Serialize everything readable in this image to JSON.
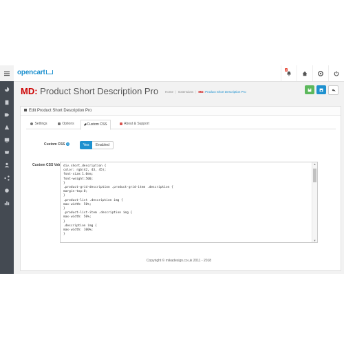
{
  "header": {
    "logo": "opencart",
    "badge_count": "2"
  },
  "page": {
    "title_prefix": "MD:",
    "title": "Product Short Description Pro",
    "breadcrumb": {
      "home": "Home",
      "extensions": "Extensions",
      "current_prefix": "MD:",
      "current": "Product Short Description Pro"
    }
  },
  "panel": {
    "heading": "Edit Product Short Description Pro",
    "tabs": [
      {
        "label": "Settings"
      },
      {
        "label": "Options"
      },
      {
        "label": "Custom CSS"
      },
      {
        "label": "About & Support"
      }
    ],
    "custom_css": {
      "label": "Custom CSS",
      "toggle_yes": "Yes",
      "toggle_state": "Enabled"
    },
    "custom_css_value": {
      "label": "Custom CSS Value",
      "lines": [
        "div.short_description {",
        "color: rgb(42, 43, 45);",
        "font-size:1.0em;",
        "font-weight:500;",
        "}",
        ".product-grid-description .product-grid-item .description {",
        "margin-top:0;",
        "}",
        ".product-list .description img {",
        "max-width: 50%;",
        "}",
        ".product-list-item .description img {",
        "max-width: 50%;",
        "}",
        ".description img {",
        "max-width: 100%;",
        "}"
      ]
    }
  },
  "footer": "Copyright © mikadesign.co.uk 2011 - 2018",
  "colors": {
    "accent": "#1e91cf",
    "save": "#5cb85c",
    "brand_red": "#cc0000",
    "sidebar": "#444a52"
  }
}
